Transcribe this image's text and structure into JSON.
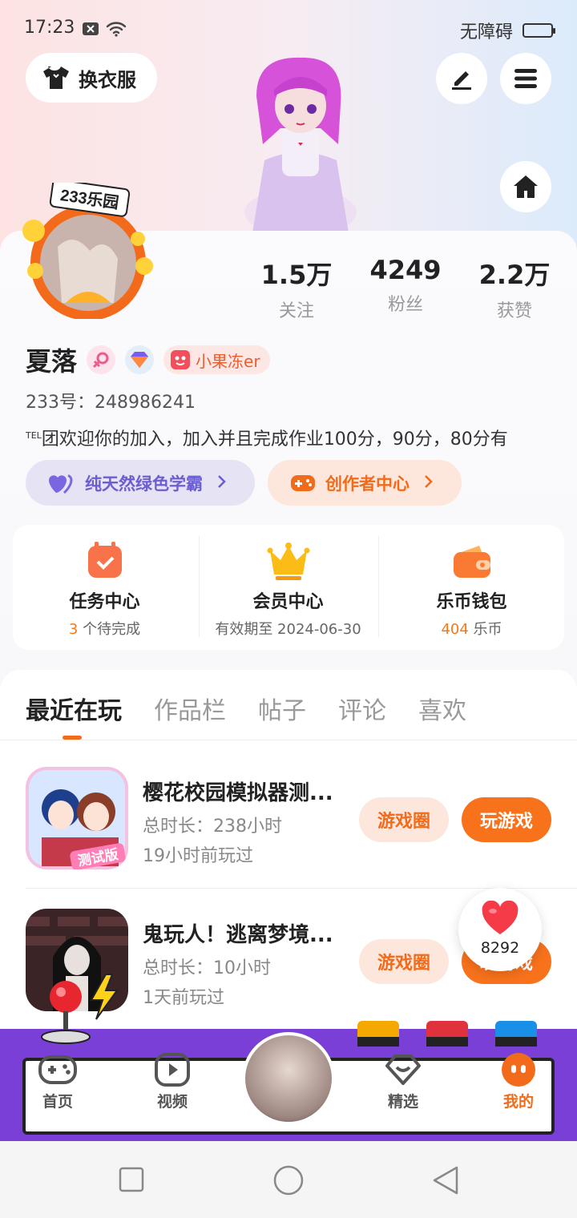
{
  "status_bar": {
    "time": "17:23",
    "accessibility": "无障碍"
  },
  "header": {
    "wardrobe_label": "换衣服"
  },
  "profile": {
    "avatar_frame_text": "233乐园",
    "name": "夏落",
    "tag": "小果冻er",
    "uid": "233号：248986241",
    "bio_prefix": "TEL",
    "bio": "团欢迎你的加入，加入并且完成作业100分，90分，80分有",
    "stats": [
      {
        "value": "1.5万",
        "label": "关注"
      },
      {
        "value": "4249",
        "label": "粉丝"
      },
      {
        "value": "2.2万",
        "label": "获赞"
      }
    ],
    "study_pill": "纯天然绿色学霸",
    "creator_pill": "创作者中心"
  },
  "services": [
    {
      "title": "任务中心",
      "highlight": "3",
      "subtitle": " 个待完成",
      "icon": "task-calendar-icon"
    },
    {
      "title": "会员中心",
      "highlight": "",
      "subtitle": "有效期至 2024-06-30",
      "icon": "crown-icon"
    },
    {
      "title": "乐币钱包",
      "highlight": "404",
      "subtitle": " 乐币",
      "icon": "wallet-icon"
    }
  ],
  "tabs": [
    "最近在玩",
    "作品栏",
    "帖子",
    "评论",
    "喜欢"
  ],
  "games": [
    {
      "title": "樱花校园模拟器测...",
      "duration": "总时长：238小时",
      "last_played": "19小时前玩过",
      "icon_badge": "测试版",
      "circle_label": "游戏圈",
      "play_label": "玩游戏"
    },
    {
      "title": "鬼玩人！逃离梦境...",
      "duration": "总时长：10小时",
      "last_played": "1天前玩过",
      "circle_label": "游戏圈",
      "play_label": "玩游戏"
    }
  ],
  "like_float": {
    "count": "8292"
  },
  "bottom_nav": [
    {
      "label": "首页",
      "icon": "gamepad-icon"
    },
    {
      "label": "视频",
      "icon": "video-play-icon"
    },
    {
      "label": "精选",
      "icon": "heart-diamond-icon"
    },
    {
      "label": "我的",
      "icon": "me-face-icon"
    }
  ],
  "colors": {
    "accent": "#f26b1a",
    "purple": "#7a3fd6",
    "study": "#6b5fd0"
  }
}
